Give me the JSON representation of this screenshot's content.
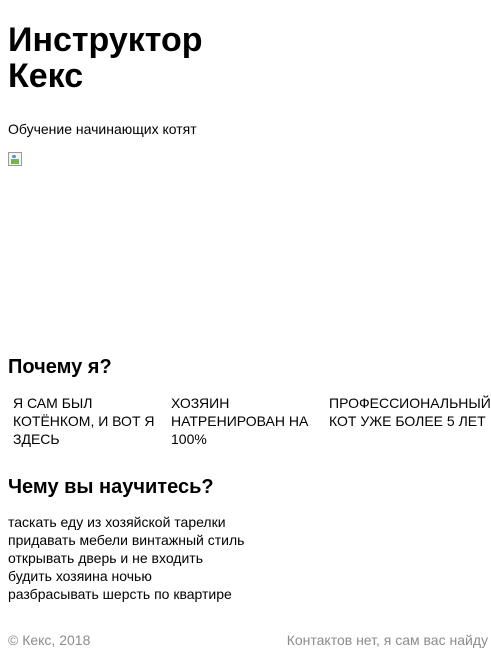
{
  "header": {
    "title_line1": "Инструктор",
    "title_line2": "Кекс",
    "subtitle": "Обучение начинающих котят"
  },
  "why": {
    "title": "Почему я?",
    "reasons": [
      "Я сам был котёнком, и вот я здесь",
      "Хозяин натренирован на 100%",
      "Профессиональный кот уже более 5 лет"
    ]
  },
  "learn": {
    "title": "Чему вы научитесь?",
    "skills": [
      "таскать еду из хозяйской тарелки",
      "придавать мебели винтажный стиль",
      "открывать дверь и не входить",
      "будить хозяина ночью",
      "разбрасывать шерсть по квартире"
    ]
  },
  "footer": {
    "copyright": "© Кекс, 2018",
    "contacts": "Контактов нет, я сам вас найду"
  },
  "icons": {
    "hero_image": "broken-image-icon"
  },
  "colors": {
    "text": "#000000",
    "footer_text": "#8c8c8c",
    "background": "#ffffff"
  }
}
